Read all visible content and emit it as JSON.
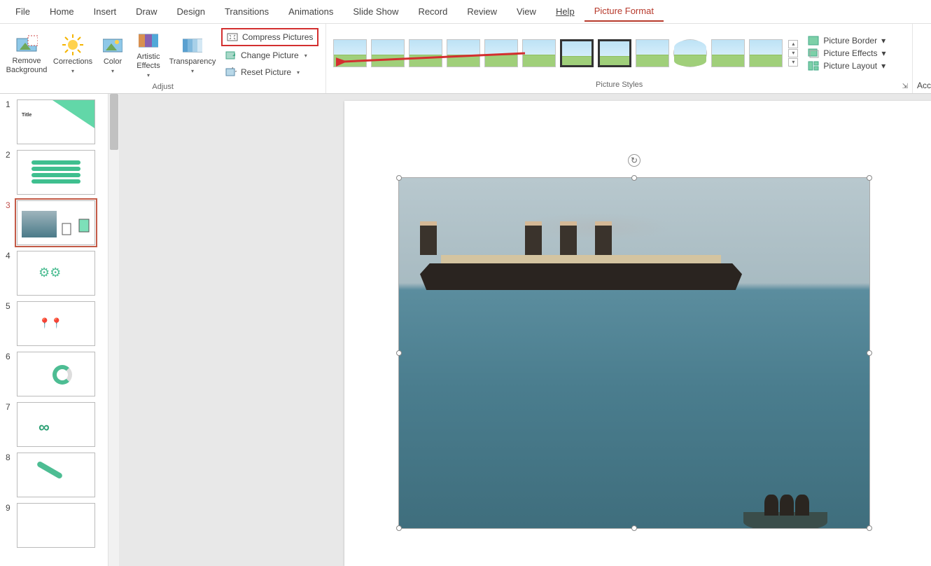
{
  "tabs": {
    "file": "File",
    "home": "Home",
    "insert": "Insert",
    "draw": "Draw",
    "design": "Design",
    "transitions": "Transitions",
    "animations": "Animations",
    "slideshow": "Slide Show",
    "record": "Record",
    "review": "Review",
    "view": "View",
    "help": "Help",
    "picture_format": "Picture Format"
  },
  "ribbon": {
    "remove_bg": "Remove\nBackground",
    "corrections": "Corrections",
    "color": "Color",
    "artistic": "Artistic\nEffects",
    "transparency": "Transparency",
    "compress": "Compress Pictures",
    "change": "Change Picture",
    "reset": "Reset Picture",
    "adjust_label": "Adjust",
    "styles_label": "Picture Styles",
    "border": "Picture Border",
    "effects": "Picture Effects",
    "layout": "Picture Layout",
    "acc": "Acc"
  },
  "slides": {
    "count": 9,
    "selected": 3,
    "nums": [
      "1",
      "2",
      "3",
      "4",
      "5",
      "6",
      "7",
      "8",
      "9"
    ]
  }
}
